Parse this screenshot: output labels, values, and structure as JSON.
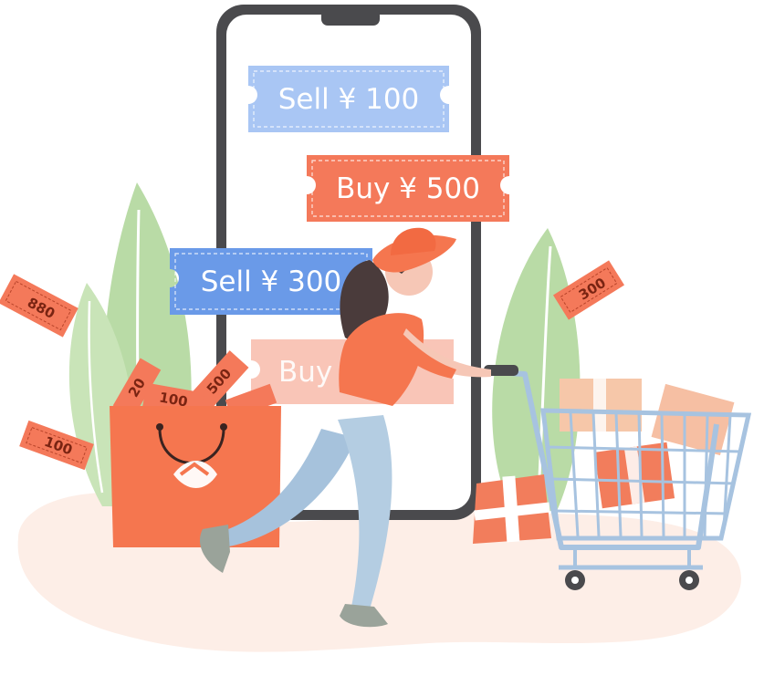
{
  "tickets": {
    "sell_100": "Sell ¥ 100",
    "buy_500": "Buy ¥ 500",
    "sell_300": "Sell  ¥ 300",
    "buy_faded": "Buy ¥"
  },
  "coupons": {
    "c880": "880",
    "c300": "300",
    "c100_left": "100",
    "c500_bag": "500",
    "c100_bag": "100",
    "c200_bag": "20"
  },
  "colors": {
    "phone_frame": "#4a4a4d",
    "sell_ticket_light": "#a9c6f4",
    "sell_ticket": "#6a9ae8",
    "buy_ticket": "#f4795a",
    "buy_ticket_faded": "#f9c5b7",
    "bag": "#f5764f",
    "leaf": "#b9dba6",
    "ground": "#fdeee7",
    "cart": "#a7c3e0"
  }
}
